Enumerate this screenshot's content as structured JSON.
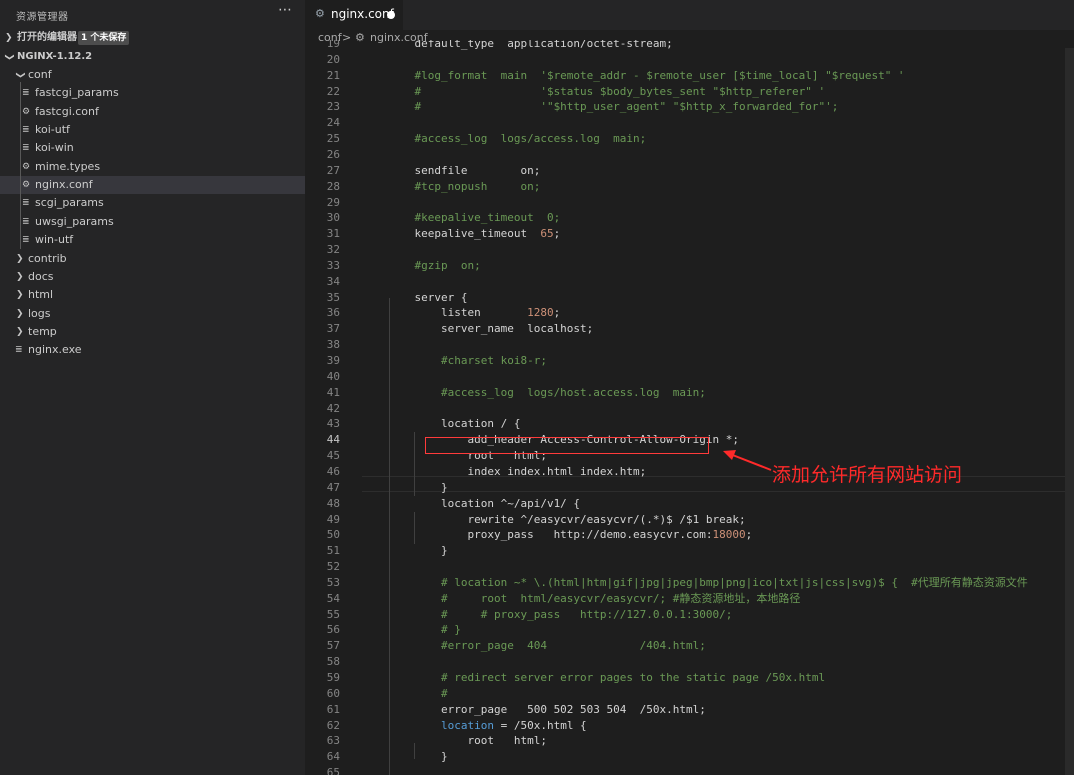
{
  "sidebar": {
    "title": "资源管理器",
    "more_icon": "more-horizontal-icon",
    "open_editors": {
      "label": "打开的编辑器",
      "badge": "1 个未保存"
    },
    "folder": {
      "label": "NGINX-1.12.2"
    },
    "tree": [
      {
        "name": "conf",
        "type": "folder-open"
      },
      {
        "name": "fastcgi_params",
        "type": "file-text"
      },
      {
        "name": "fastcgi.conf",
        "type": "file-gear"
      },
      {
        "name": "koi-utf",
        "type": "file-text"
      },
      {
        "name": "koi-win",
        "type": "file-text"
      },
      {
        "name": "mime.types",
        "type": "file-gear"
      },
      {
        "name": "nginx.conf",
        "type": "file-gear"
      },
      {
        "name": "scgi_params",
        "type": "file-text"
      },
      {
        "name": "uwsgi_params",
        "type": "file-text"
      },
      {
        "name": "win-utf",
        "type": "file-text"
      },
      {
        "name": "contrib",
        "type": "folder"
      },
      {
        "name": "docs",
        "type": "folder"
      },
      {
        "name": "html",
        "type": "folder"
      },
      {
        "name": "logs",
        "type": "folder"
      },
      {
        "name": "temp",
        "type": "folder"
      },
      {
        "name": "nginx.exe",
        "type": "file-text"
      }
    ]
  },
  "tab": {
    "label": "nginx.conf",
    "icon": "gear-icon",
    "unsaved": true
  },
  "breadcrumb": {
    "folder": "conf",
    "separator": ">",
    "file": "nginx.conf"
  },
  "annotation": {
    "text": "添加允许所有网站访问",
    "color": "#ff2a2a"
  },
  "code": [
    {
      "n": "19",
      "t": "    default_type  application/octet-stream;"
    },
    {
      "n": "20",
      "t": ""
    },
    {
      "n": "21",
      "t": "    #log_format  main  '$remote_addr - $remote_user [$time_local] \"$request\" '"
    },
    {
      "n": "22",
      "t": "    #                  '$status $body_bytes_sent \"$http_referer\" '"
    },
    {
      "n": "23",
      "t": "    #                  '\"$http_user_agent\" \"$http_x_forwarded_for\"';"
    },
    {
      "n": "24",
      "t": ""
    },
    {
      "n": "25",
      "t": "    #access_log  logs/access.log  main;"
    },
    {
      "n": "26",
      "t": ""
    },
    {
      "n": "27",
      "t": "    sendfile        on;"
    },
    {
      "n": "28",
      "t": "    #tcp_nopush     on;"
    },
    {
      "n": "29",
      "t": ""
    },
    {
      "n": "30",
      "t": "    #keepalive_timeout  0;"
    },
    {
      "n": "31",
      "t": "    keepalive_timeout  65;"
    },
    {
      "n": "32",
      "t": ""
    },
    {
      "n": "33",
      "t": "    #gzip  on;"
    },
    {
      "n": "34",
      "t": ""
    },
    {
      "n": "35",
      "t": "    server {"
    },
    {
      "n": "36",
      "t": "        listen       1280;"
    },
    {
      "n": "37",
      "t": "        server_name  localhost;"
    },
    {
      "n": "38",
      "t": ""
    },
    {
      "n": "39",
      "t": "        #charset koi8-r;"
    },
    {
      "n": "40",
      "t": ""
    },
    {
      "n": "41",
      "t": "        #access_log  logs/host.access.log  main;"
    },
    {
      "n": "42",
      "t": ""
    },
    {
      "n": "43",
      "t": "        location / {"
    },
    {
      "n": "44",
      "t": "            add_header Access-Control-Allow-Origin *;"
    },
    {
      "n": "45",
      "t": "            root   html;"
    },
    {
      "n": "46",
      "t": "            index index.html index.htm;"
    },
    {
      "n": "47",
      "t": "        }"
    },
    {
      "n": "48",
      "t": "        location ^~/api/v1/ {"
    },
    {
      "n": "49",
      "t": "            rewrite ^/easycvr/easycvr/(.*)$ /$1 break;"
    },
    {
      "n": "50",
      "t": "            proxy_pass   http://demo.easycvr.com:18000;"
    },
    {
      "n": "51",
      "t": "        }"
    },
    {
      "n": "52",
      "t": ""
    },
    {
      "n": "53",
      "t": "        # location ~* \\.(html|htm|gif|jpg|jpeg|bmp|png|ico|txt|js|css|svg)$ {  #代理所有静态资源文件"
    },
    {
      "n": "54",
      "t": "        #     root  html/easycvr/easycvr/; #静态资源地址，本地路径"
    },
    {
      "n": "55",
      "t": "        #     # proxy_pass   http://127.0.0.1:3000/;"
    },
    {
      "n": "56",
      "t": "        # }"
    },
    {
      "n": "57",
      "t": "        #error_page  404              /404.html;"
    },
    {
      "n": "58",
      "t": ""
    },
    {
      "n": "59",
      "t": "        # redirect server error pages to the static page /50x.html"
    },
    {
      "n": "60",
      "t": "        #"
    },
    {
      "n": "61",
      "t": "        error_page   500 502 503 504  /50x.html;"
    },
    {
      "n": "62",
      "t": "        location = /50x.html {"
    },
    {
      "n": "63",
      "t": "            root   html;"
    },
    {
      "n": "64",
      "t": "        }"
    },
    {
      "n": "65",
      "t": ""
    }
  ]
}
